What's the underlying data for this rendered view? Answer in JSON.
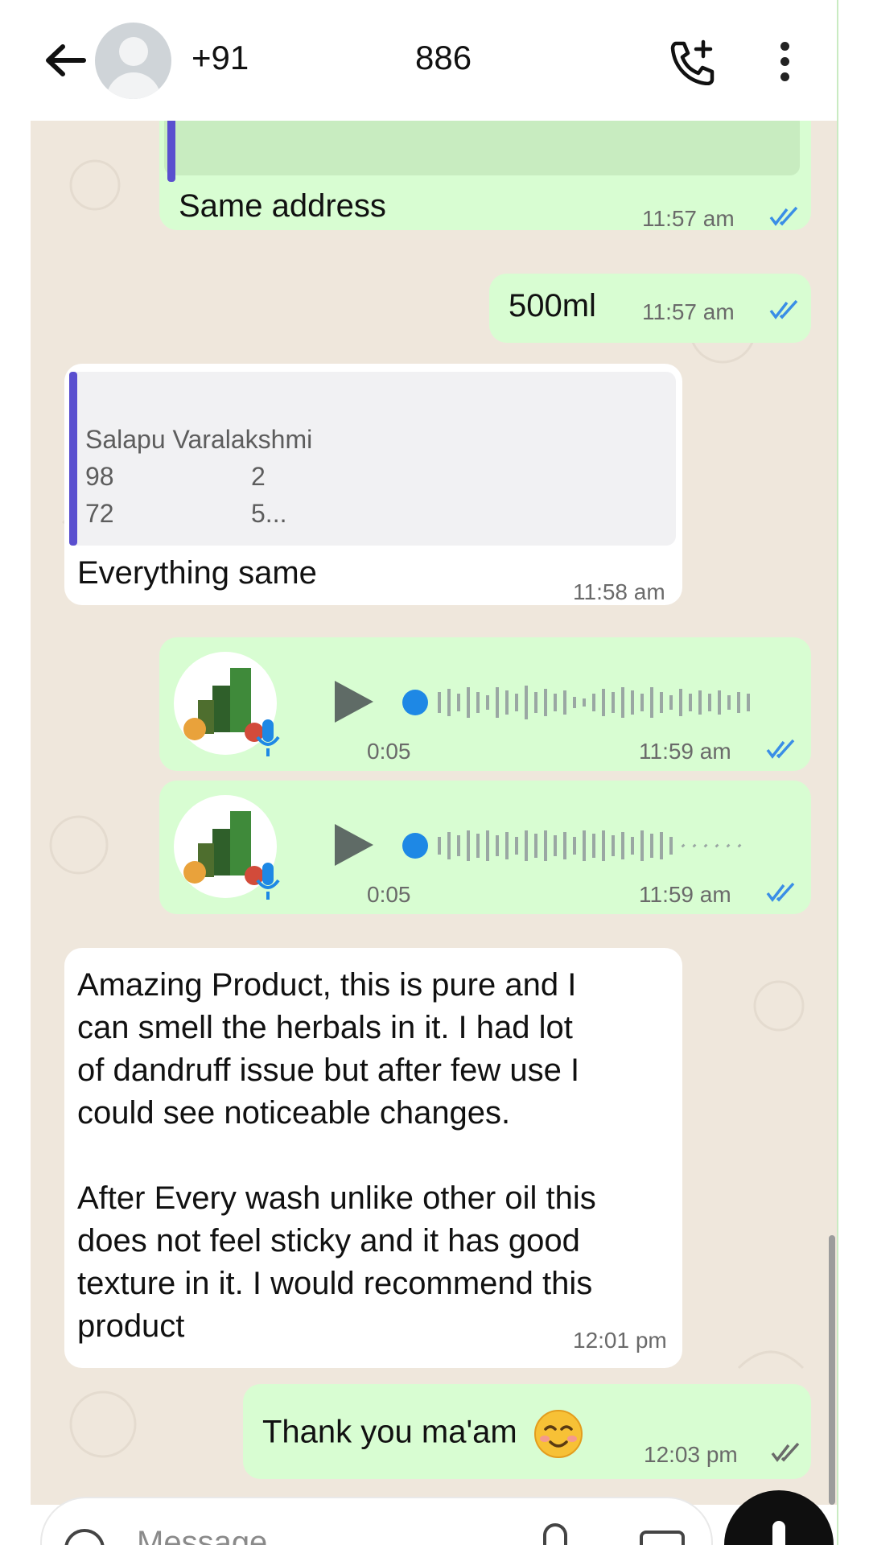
{
  "header": {
    "phone_prefix": "+91",
    "phone_suffix": "886",
    "back_icon": "back-arrow-icon",
    "call_icon": "add-call-icon",
    "menu_icon": "more-vertical-icon"
  },
  "messages": [
    {
      "kind": "out",
      "text": "Same address",
      "time": "11:57 am",
      "status": "read"
    },
    {
      "kind": "out",
      "text": "500ml",
      "time": "11:57 am",
      "status": "read"
    },
    {
      "kind": "in",
      "quote": {
        "name": "Salapu Varalakshmi",
        "line1_a": "98",
        "line1_b": "2",
        "line2_a": "72",
        "line2_b": "5..."
      },
      "text": "Everything same",
      "time": "11:58 am"
    },
    {
      "kind": "out-voice",
      "duration": "0:05",
      "time": "11:59 am",
      "status": "read"
    },
    {
      "kind": "out-voice",
      "duration": "0:05",
      "time": "11:59 am",
      "status": "read"
    },
    {
      "kind": "in",
      "text_p1_l1": "Amazing Product, this is pure and I",
      "text_p1_l2": "can smell the herbals in it. I had lot",
      "text_p1_l3": "of dandruff issue but after few use I",
      "text_p1_l4": "could see noticeable changes.",
      "text_p2_l1": "After Every wash unlike other oil this",
      "text_p2_l2": "does not feel sticky and it has good",
      "text_p2_l3": "texture in it. I would recommend this",
      "text_p2_l4": "product",
      "time": "12:01 pm"
    },
    {
      "kind": "out",
      "text": "Thank you ma'am",
      "emoji": "smiling-face-emoji",
      "time": "12:03 pm",
      "status": "read"
    }
  ],
  "input": {
    "placeholder": "Message",
    "emoji_icon": "emoji-icon",
    "attach_icon": "attach-icon",
    "camera_icon": "camera-icon",
    "mic_icon": "mic-icon"
  },
  "colors": {
    "outgoing_bubble": "#d8fdd2",
    "incoming_bubble": "#ffffff",
    "chat_background": "#efe7dc",
    "read_tick": "#3a8ee6",
    "voice_accent": "#1e88e5"
  }
}
